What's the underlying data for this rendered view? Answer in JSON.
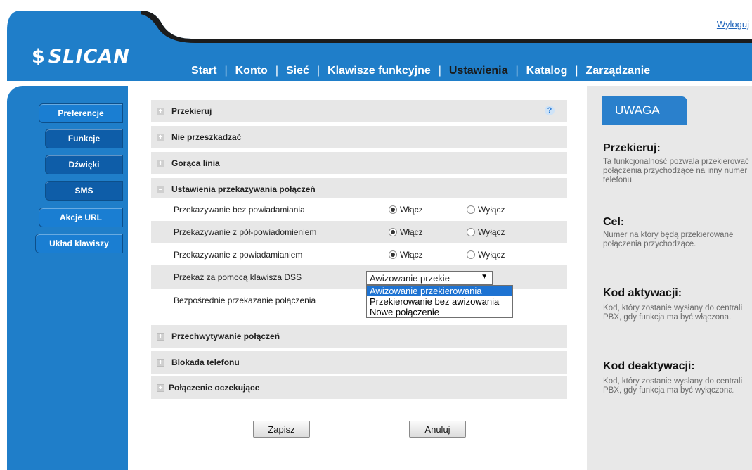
{
  "header": {
    "logout": "Wyloguj",
    "logo_text": "SLICAN",
    "logo_mark": "$",
    "nav": [
      {
        "label": "Start"
      },
      {
        "label": "Konto"
      },
      {
        "label": "Sieć"
      },
      {
        "label": "Klawisze funkcyjne"
      },
      {
        "label": "Ustawienia"
      },
      {
        "label": "Katalog"
      },
      {
        "label": "Zarządzanie"
      }
    ],
    "active_nav": "Ustawienia"
  },
  "sidebar": {
    "items": [
      {
        "label": "Preferencje"
      },
      {
        "label": "Funkcje"
      },
      {
        "label": "Dźwięki"
      },
      {
        "label": "SMS"
      },
      {
        "label": "Akcje URL"
      },
      {
        "label": "Układ klawiszy"
      }
    ]
  },
  "main": {
    "sections_top": [
      {
        "label": "Przekieruj",
        "expander": "+"
      },
      {
        "label": "Nie przeszkadzać",
        "expander": "+"
      },
      {
        "label": "Gorąca linia",
        "expander": "+"
      },
      {
        "label": "Ustawienia przekazywania połączeń",
        "expander": "–"
      }
    ],
    "help_icon": "?",
    "transfer_rows": [
      {
        "label": "Przekazywanie bez powiadamiania",
        "on": "Włącz",
        "off": "Wyłącz",
        "value": "on"
      },
      {
        "label": "Przekazywanie z pół-powiadomieniem",
        "on": "Włącz",
        "off": "Wyłącz",
        "value": "on"
      },
      {
        "label": "Przekazywanie z powiadamianiem",
        "on": "Włącz",
        "off": "Wyłącz",
        "value": "on"
      }
    ],
    "dss": {
      "label": "Przekaż za pomocą klawisza DSS",
      "selected": "Awizowanie przekie",
      "arrow": "▼",
      "options": [
        "Awizowanie przekierowania",
        "Przekierowanie bez awizowania",
        "Nowe połączenie"
      ]
    },
    "direct": {
      "label": "Bezpośrednie przekazanie połączenia"
    },
    "sections_bottom": [
      {
        "label": "Przechwytywanie połączeń",
        "expander": "+"
      },
      {
        "label": "Blokada telefonu",
        "expander": "+"
      },
      {
        "label": "Połączenie oczekujące",
        "expander": "+"
      }
    ],
    "save_label": "Zapisz",
    "cancel_label": "Anuluj"
  },
  "note": {
    "title": "UWAGA",
    "items": [
      {
        "title": "Przekieruj:",
        "text": "Ta funkcjonalność pozwala przekierować połączenia przychodzące na inny numer telefonu."
      },
      {
        "title": "Cel:",
        "text": "Numer na który będą przekierowane połączenia przychodzące."
      },
      {
        "title": "Kod aktywacji:",
        "text": "Kod, który zostanie wysłany do centrali PBX, gdy funkcja ma być włączona."
      },
      {
        "title": "Kod deaktywacji:",
        "text": "Kod, który zostanie wysłany do centrali PBX, gdy funkcja ma być wyłączona."
      }
    ]
  },
  "colors": {
    "brand_blue": "#1f7ec9",
    "dark_curve": "#1c1c1c",
    "selected_option": "#1e73d2"
  }
}
